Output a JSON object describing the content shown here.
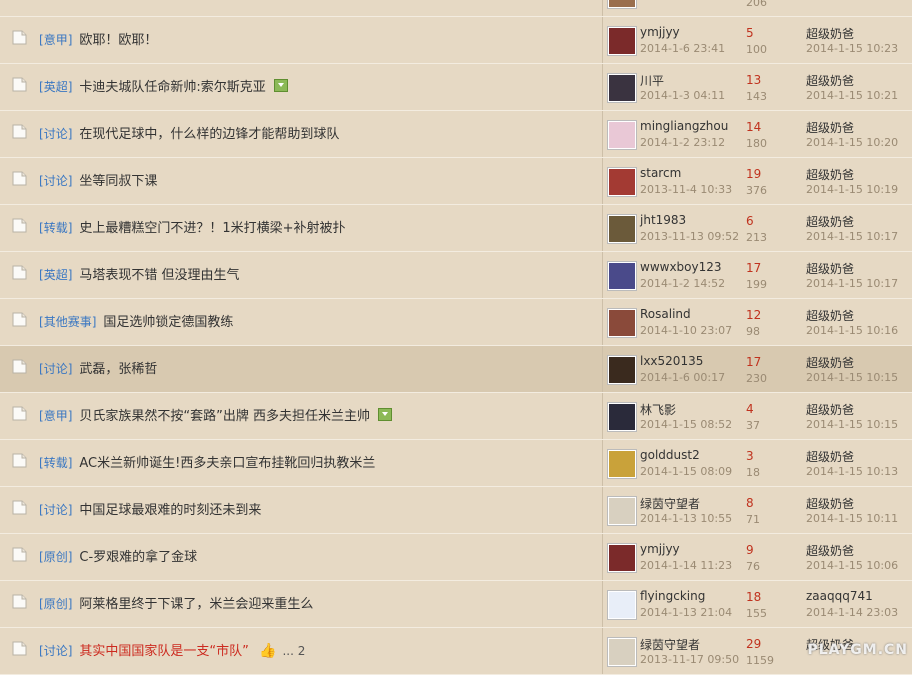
{
  "threads": [
    {
      "tag": "",
      "title": "",
      "title_color": "",
      "author": "",
      "post_date": "",
      "replies": "",
      "views": "206",
      "last_user": "",
      "last_date": "",
      "avatar_color": "#9a6f4e",
      "highlight": false,
      "image": false
    },
    {
      "tag": "意甲",
      "title": "欧耶！欧耶！",
      "author": "ymjjyy",
      "post_date": "2014-1-6 23:41",
      "replies": "5",
      "views": "100",
      "last_user": "超级奶爸",
      "last_date": "2014-1-15 10:23",
      "avatar_color": "#7b2a2a",
      "highlight": false,
      "image": false
    },
    {
      "tag": "英超",
      "title": "卡迪夫城队任命新帅:索尔斯克亚",
      "author": "川平",
      "post_date": "2014-1-3 04:11",
      "replies": "13",
      "views": "143",
      "last_user": "超级奶爸",
      "last_date": "2014-1-15 10:21",
      "avatar_color": "#3a3340",
      "highlight": false,
      "image": true
    },
    {
      "tag": "讨论",
      "title": "在现代足球中，什么样的边锋才能帮助到球队",
      "author": "mingliangzhou",
      "post_date": "2014-1-2 23:12",
      "replies": "14",
      "views": "180",
      "last_user": "超级奶爸",
      "last_date": "2014-1-15 10:20",
      "avatar_color": "#e9c8d6",
      "highlight": false,
      "image": false
    },
    {
      "tag": "讨论",
      "title": "坐等同叔下课",
      "author": "starcm",
      "post_date": "2013-11-4 10:33",
      "replies": "19",
      "views": "376",
      "last_user": "超级奶爸",
      "last_date": "2014-1-15 10:19",
      "avatar_color": "#a33a33",
      "highlight": false,
      "image": false
    },
    {
      "tag": "转载",
      "title": "史上最糟糕空门不进？！1米打横梁+补射被扑",
      "author": "jht1983",
      "post_date": "2013-11-13 09:52",
      "replies": "6",
      "views": "213",
      "last_user": "超级奶爸",
      "last_date": "2014-1-15 10:17",
      "avatar_color": "#6b5a3a",
      "highlight": false,
      "image": false
    },
    {
      "tag": "英超",
      "title": "马塔表现不错 但没理由生气",
      "author": "wwwxboy123",
      "post_date": "2014-1-2 14:52",
      "replies": "17",
      "views": "199",
      "last_user": "超级奶爸",
      "last_date": "2014-1-15 10:17",
      "avatar_color": "#4a4a8a",
      "highlight": false,
      "image": false
    },
    {
      "tag": "其他赛事",
      "title": "国足选帅锁定德国教练",
      "author": "Rosalind",
      "post_date": "2014-1-10 23:07",
      "replies": "12",
      "views": "98",
      "last_user": "超级奶爸",
      "last_date": "2014-1-15 10:16",
      "avatar_color": "#8a4a3a",
      "highlight": false,
      "image": false
    },
    {
      "tag": "讨论",
      "title": "武磊，张稀哲",
      "author": "lxx520135",
      "post_date": "2014-1-6 00:17",
      "replies": "17",
      "views": "230",
      "last_user": "超级奶爸",
      "last_date": "2014-1-15 10:15",
      "avatar_color": "#3a2a1e",
      "highlight": true,
      "image": false
    },
    {
      "tag": "意甲",
      "title": "贝氏家族果然不按“套路”出牌 西多夫担任米兰主帅",
      "author": "林飞影",
      "post_date": "2014-1-15 08:52",
      "replies": "4",
      "views": "37",
      "last_user": "超级奶爸",
      "last_date": "2014-1-15 10:15",
      "avatar_color": "#2a2a3a",
      "highlight": false,
      "image": true
    },
    {
      "tag": "转载",
      "title": "AC米兰新帅诞生!西多夫亲口宣布挂靴回归执教米兰",
      "author": "golddust2",
      "post_date": "2014-1-15 08:09",
      "replies": "3",
      "views": "18",
      "last_user": "超级奶爸",
      "last_date": "2014-1-15 10:13",
      "avatar_color": "#c9a23a",
      "highlight": false,
      "image": false
    },
    {
      "tag": "讨论",
      "title": "中国足球最艰难的时刻还未到来",
      "author": "绿茵守望者",
      "post_date": "2014-1-13 10:55",
      "replies": "8",
      "views": "71",
      "last_user": "超级奶爸",
      "last_date": "2014-1-15 10:11",
      "avatar_color": "#d8d0c0",
      "highlight": false,
      "image": false
    },
    {
      "tag": "原创",
      "title": "C-罗艰难的拿了金球",
      "author": "ymjjyy",
      "post_date": "2014-1-14 11:23",
      "replies": "9",
      "views": "76",
      "last_user": "超级奶爸",
      "last_date": "2014-1-15 10:06",
      "avatar_color": "#7b2a2a",
      "highlight": false,
      "image": false
    },
    {
      "tag": "原创",
      "title": "阿莱格里终于下课了，米兰会迎来重生么",
      "author": "flyingcking",
      "post_date": "2014-1-13 21:04",
      "replies": "18",
      "views": "155",
      "last_user": "zaaqqq741",
      "last_date": "2014-1-14 23:03",
      "avatar_color": "#e8eef8",
      "highlight": false,
      "image": false
    },
    {
      "tag": "讨论",
      "title": "其实中国国家队是一支“市队”",
      "title_color": "red",
      "author": "绿茵守望者",
      "post_date": "2013-11-17 09:50",
      "replies": "29",
      "views": "1159",
      "last_user": "超级奶爸",
      "last_date": "",
      "avatar_color": "#d8d0c0",
      "highlight": false,
      "image": false,
      "hand": true,
      "pages": "... 2"
    }
  ],
  "watermark": "PLAYGM.CN"
}
